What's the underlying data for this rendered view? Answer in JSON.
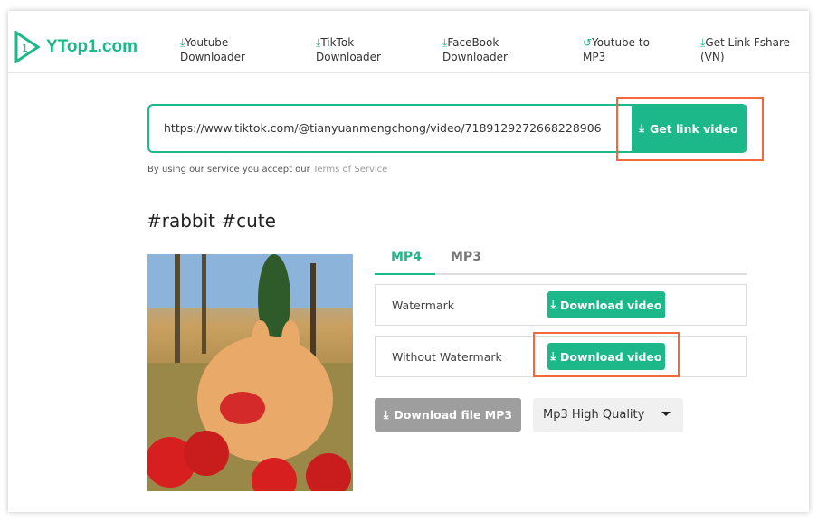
{
  "header": {
    "logo_text": "YTop1.com",
    "nav": [
      {
        "icon": "download-icon",
        "line1": "Youtube",
        "line2": "Downloader"
      },
      {
        "icon": "download-icon",
        "line1": "TikTok",
        "line2": "Downloader"
      },
      {
        "icon": "download-icon",
        "line1": "FaceBook",
        "line2": "Downloader"
      },
      {
        "icon": "convert-icon",
        "line1": "Youtube to",
        "line2": "MP3"
      },
      {
        "icon": "download-icon",
        "line1": "Get Link Fshare",
        "line2": "(VN)"
      }
    ]
  },
  "search": {
    "url": "https://www.tiktok.com/@tianyuanmengchong/video/7189129272668228906",
    "button": "Get link video"
  },
  "terms": {
    "text": "By using our service you accept our ",
    "link": "Terms of Service"
  },
  "video": {
    "title": "#rabbit #cute"
  },
  "tabs": [
    {
      "label": "MP4",
      "active": true
    },
    {
      "label": "MP3",
      "active": false
    }
  ],
  "rows": [
    {
      "label": "Watermark",
      "button": "Download video"
    },
    {
      "label": "Without Watermark",
      "button": "Download video"
    }
  ],
  "mp3": {
    "button": "Download file MP3",
    "quality": "Mp3 High Quality"
  },
  "colors": {
    "accent": "#1db88a",
    "highlight": "#f26a3c"
  }
}
